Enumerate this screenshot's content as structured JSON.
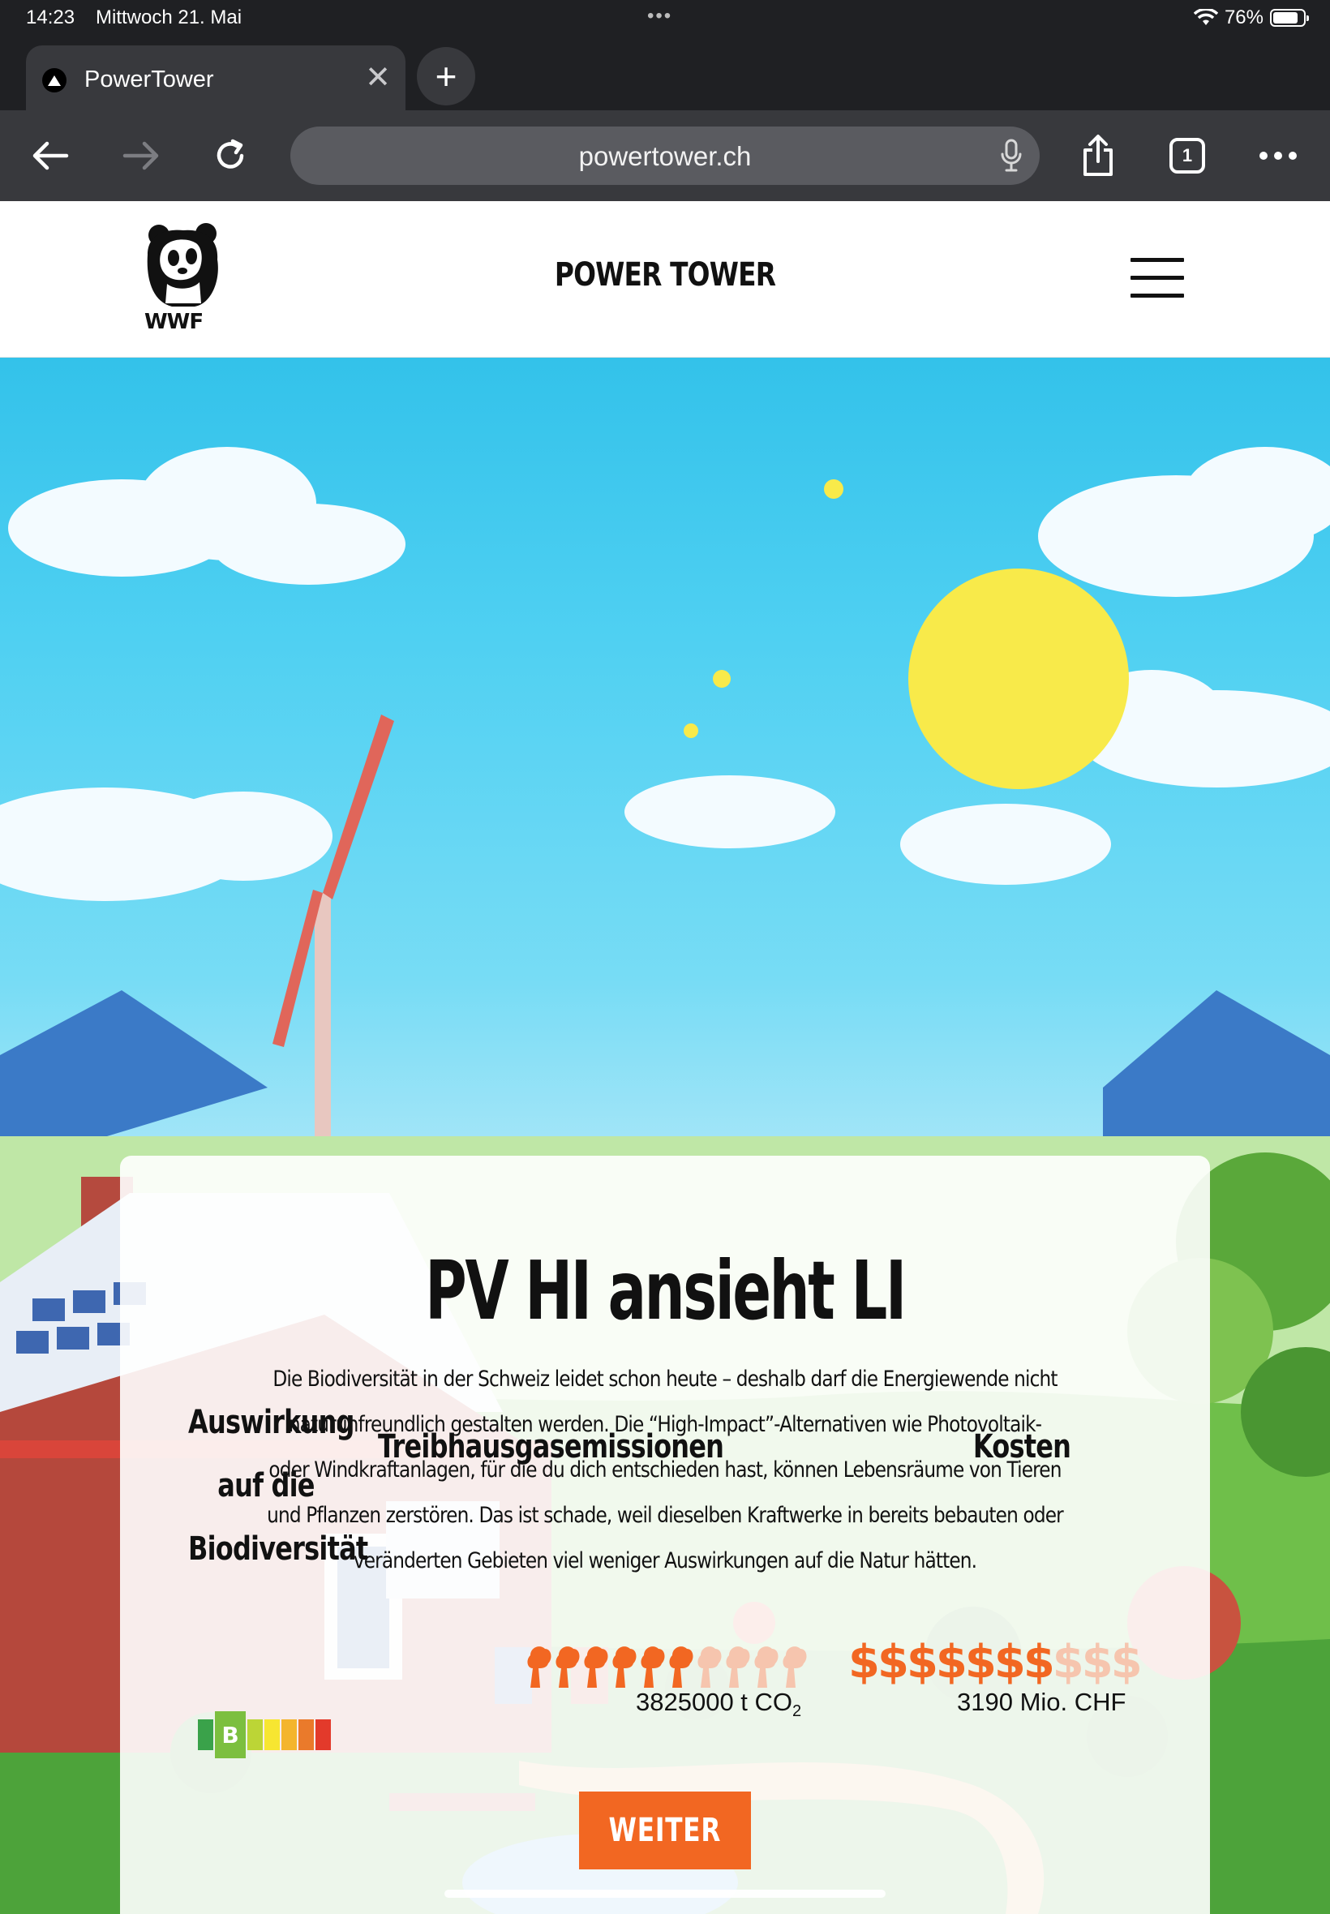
{
  "status_bar": {
    "time": "14:23",
    "date": "Mittwoch 21. Mai",
    "battery": "76%",
    "battery_level": 0.76
  },
  "browser": {
    "tab_title": "PowerTower",
    "url": "powertower.ch",
    "tab_count": "1"
  },
  "site": {
    "title": "POWER TOWER",
    "logo_text": "WWF"
  },
  "card": {
    "title": "PV HI ansieht LI",
    "text": "Die Biodiversität in der Schweiz leidet schon heute – deshalb darf die Energiewende nicht naturunfreundlich gestalten werden. Die “High-Impact”-Alternativen wie Photovoltaik- oder Windkraftanlagen, für die du dich entschieden hast, können Lebensräume von Tieren und Pflanzen zerstören. Das ist schade, weil dieselben Kraftwerke in bereits bebauten oder veränderten Gebieten viel weniger Auswirkungen auf die Natur hätten.",
    "biodiversity": {
      "heading_line1": "Auswirkung auf die",
      "heading_line2": "Biodiversität",
      "rating": "B",
      "scale_colors": [
        "#3aa24a",
        "#7cbf3f",
        "#bcd536",
        "#f7e631",
        "#f4b52d",
        "#ea7a2b",
        "#e33a2b"
      ],
      "active_index": 1
    },
    "emissions": {
      "heading": "Treibhausgasemissionen",
      "value": "3825000 t CO",
      "value_sub": "2",
      "filled": 6,
      "total": 10,
      "color_on": "#f26722",
      "color_off": "#f6c5ae"
    },
    "costs": {
      "heading": "Kosten",
      "value": "3190 Mio. CHF",
      "filled": 7,
      "total": 10,
      "symbol": "$"
    },
    "button": "WEITER"
  }
}
